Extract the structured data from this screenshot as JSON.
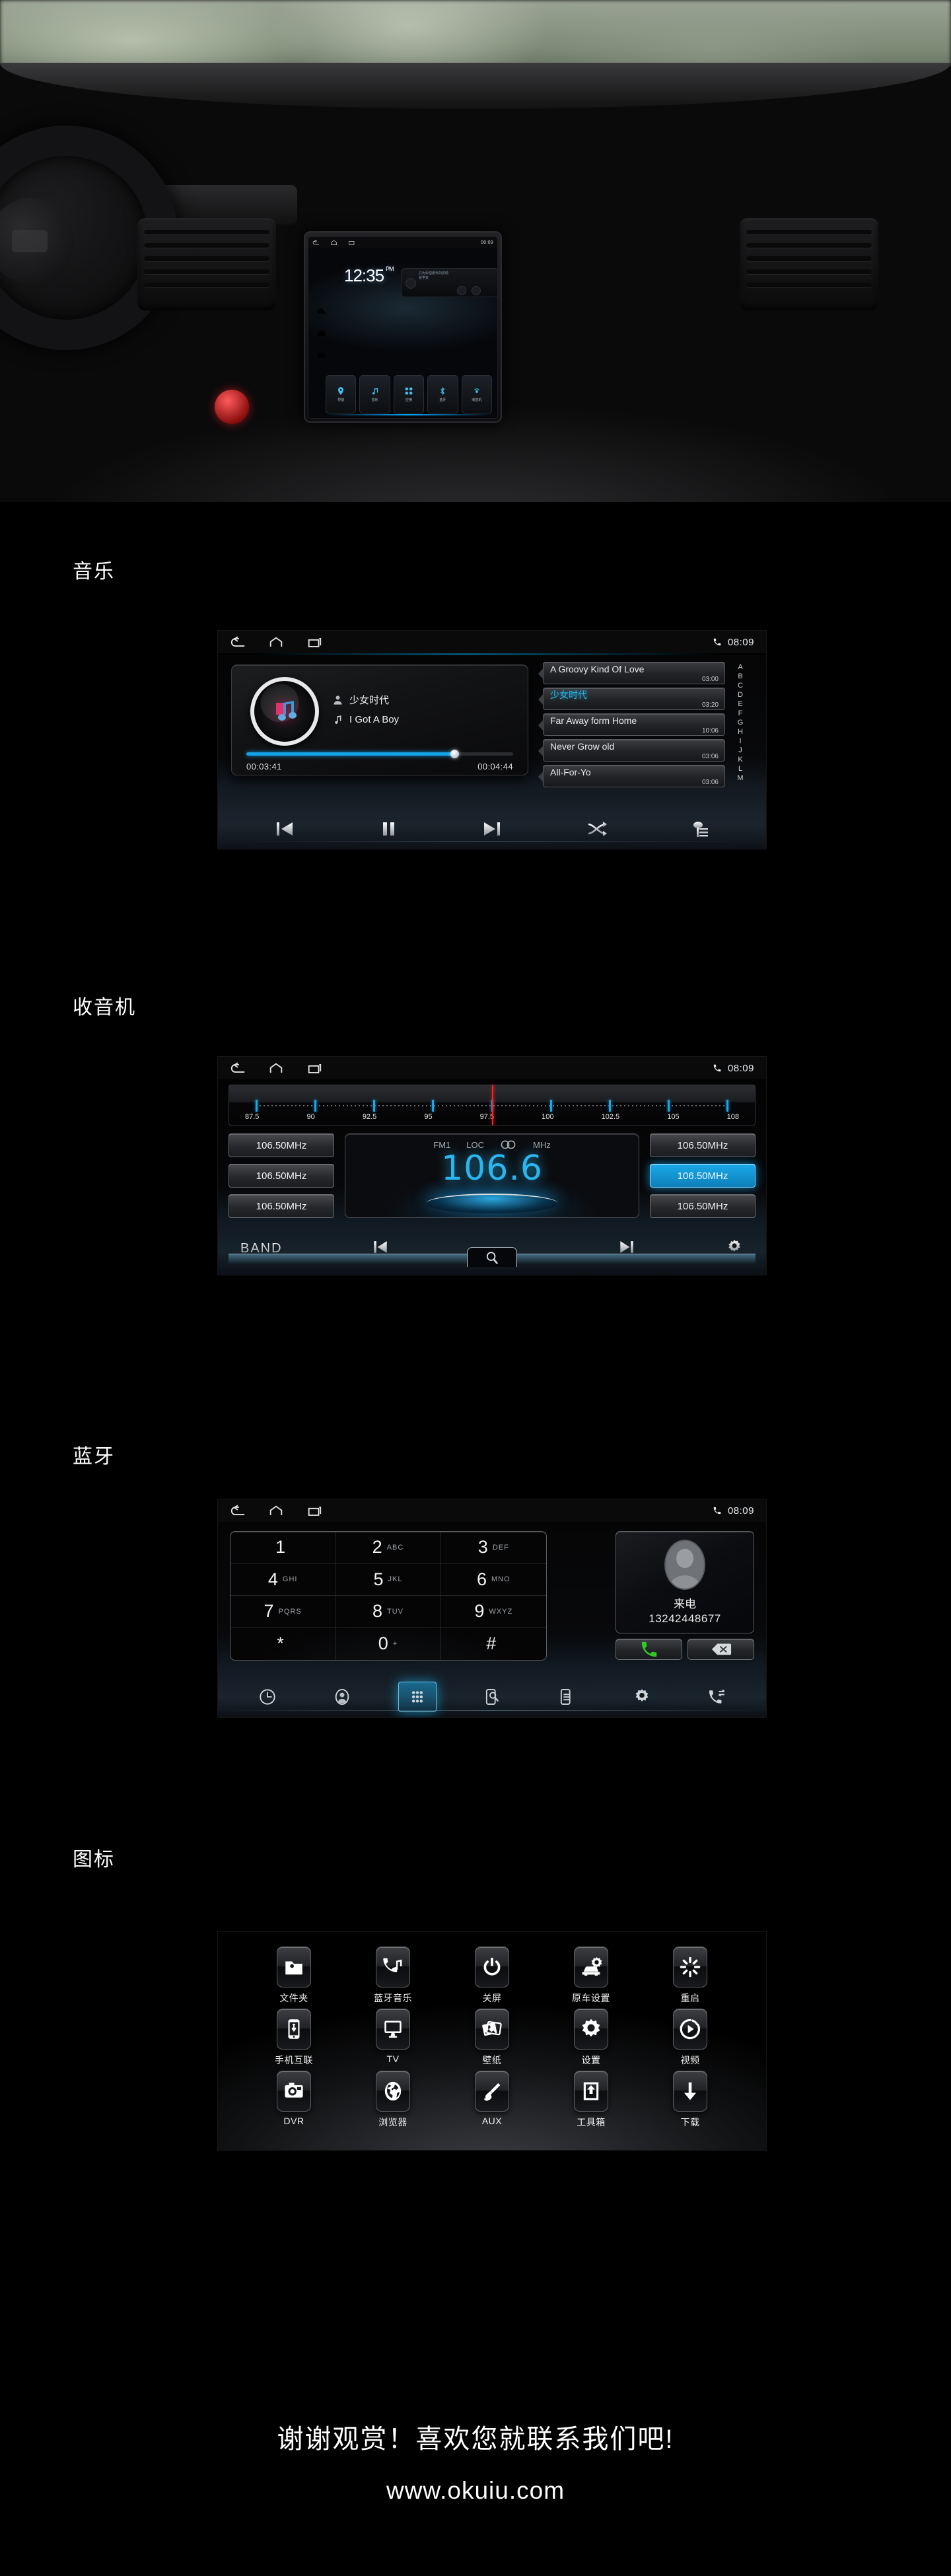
{
  "hero": {
    "headunit": {
      "status_time": "08:09",
      "clock": "12:35",
      "clock_meridiem": "PM",
      "media_line1": "只为永恒那天的爱情",
      "media_line2": "张学友",
      "dock": [
        {
          "label": "导航",
          "icon": "map-pin-icon"
        },
        {
          "label": "音乐",
          "icon": "music-note-icon"
        },
        {
          "label": "应用",
          "icon": "apps-grid-icon"
        },
        {
          "label": "蓝牙",
          "icon": "bluetooth-icon"
        },
        {
          "label": "收音机",
          "icon": "radio-icon"
        }
      ]
    }
  },
  "sections": {
    "music": {
      "title": "音乐"
    },
    "radio": {
      "title": "收音机"
    },
    "bluetooth": {
      "title": "蓝牙"
    },
    "icons": {
      "title": "图标"
    }
  },
  "statusbar": {
    "time": "08:09",
    "back_icon": "back-arrow-icon",
    "home_icon": "home-icon",
    "recents_icon": "recents-icon",
    "phone_icon": "phone-icon"
  },
  "music": {
    "artist": "少女时代",
    "song": "I Got A Boy",
    "elapsed": "00:03:41",
    "duration": "00:04:44",
    "progress_percent": 78,
    "playlist": [
      {
        "title": "A Groovy Kind Of Love",
        "duration": "03:00",
        "active": false
      },
      {
        "title": "少女时代",
        "duration": "03:20",
        "active": true
      },
      {
        "title": "Far Away form Home",
        "duration": "10:06",
        "active": false
      },
      {
        "title": "Never Grow old",
        "duration": "03:06",
        "active": false
      },
      {
        "title": "All-For-Yo",
        "duration": "03:06",
        "active": false
      }
    ],
    "alpha_index": [
      "A",
      "B",
      "C",
      "D",
      "E",
      "F",
      "G",
      "H",
      "I",
      "J",
      "K",
      "L",
      "M"
    ],
    "controls": [
      {
        "name": "previous",
        "icon": "skip-previous-icon"
      },
      {
        "name": "pause",
        "icon": "pause-icon"
      },
      {
        "name": "next",
        "icon": "skip-next-icon"
      },
      {
        "name": "shuffle",
        "icon": "shuffle-icon"
      },
      {
        "name": "playlist",
        "icon": "playlist-icon"
      }
    ],
    "accent_color": "#12a3e8"
  },
  "radio": {
    "scale_labels": [
      "87.5",
      "90",
      "92.5",
      "95",
      "97.5",
      "100",
      "102.5",
      "105",
      "108"
    ],
    "needle_percent": 50,
    "band": "FM1",
    "mode": "LOC",
    "stereo_icon": "stereo-icon",
    "unit": "MHz",
    "frequency": "106.6",
    "presets_left": [
      "106.50MHz",
      "106.50MHz",
      "106.50MHz"
    ],
    "presets_right": [
      "106.50MHz",
      "106.50MHz",
      "106.50MHz"
    ],
    "selected_preset_index": 1,
    "band_label": "BAND",
    "controls": [
      {
        "name": "seek-down",
        "icon": "skip-previous-icon"
      },
      {
        "name": "scan",
        "icon": "search-icon"
      },
      {
        "name": "seek-up",
        "icon": "skip-next-icon"
      },
      {
        "name": "settings",
        "icon": "gear-icon"
      }
    ],
    "accent_color": "#2ab6ef",
    "needle_color": "#ff2020"
  },
  "bluetooth": {
    "keys": [
      {
        "num": "1",
        "sub": ""
      },
      {
        "num": "2",
        "sub": "ABC"
      },
      {
        "num": "3",
        "sub": "DEF"
      },
      {
        "num": "4",
        "sub": "GHI"
      },
      {
        "num": "5",
        "sub": "JKL"
      },
      {
        "num": "6",
        "sub": "MNO"
      },
      {
        "num": "7",
        "sub": "PQRS"
      },
      {
        "num": "8",
        "sub": "TUV"
      },
      {
        "num": "9",
        "sub": "WXYZ"
      },
      {
        "num": "*",
        "sub": ""
      },
      {
        "num": "0",
        "sub": "+"
      },
      {
        "num": "#",
        "sub": ""
      }
    ],
    "call_status": "来电",
    "call_number": "13242448677",
    "answer_icon": "phone-answer-icon",
    "delete_icon": "backspace-icon",
    "nav": [
      {
        "name": "call-history",
        "icon": "clock-icon",
        "active": false
      },
      {
        "name": "contacts",
        "icon": "contact-icon",
        "active": false
      },
      {
        "name": "keypad",
        "icon": "keypad-icon",
        "active": true
      },
      {
        "name": "search-phone",
        "icon": "phone-search-icon",
        "active": false
      },
      {
        "name": "sync-records",
        "icon": "phone-list-icon",
        "active": false
      },
      {
        "name": "bt-settings",
        "icon": "gear-icon",
        "active": false
      },
      {
        "name": "transfer-audio",
        "icon": "call-transfer-icon",
        "active": false
      }
    ],
    "accent_color": "#1eaae6"
  },
  "icons_grid": [
    {
      "label": "文件夹",
      "icon": "folder-icon"
    },
    {
      "label": "蓝牙音乐",
      "icon": "bluetooth-music-icon"
    },
    {
      "label": "关屏",
      "icon": "power-icon"
    },
    {
      "label": "原车设置",
      "icon": "car-settings-icon"
    },
    {
      "label": "重启",
      "icon": "restart-icon"
    },
    {
      "label": "手机互联",
      "icon": "phone-link-icon"
    },
    {
      "label": "TV",
      "icon": "tv-icon"
    },
    {
      "label": "壁纸",
      "icon": "wallpaper-icon"
    },
    {
      "label": "设置",
      "icon": "gear-icon"
    },
    {
      "label": "视频",
      "icon": "video-icon"
    },
    {
      "label": "DVR",
      "icon": "camera-icon"
    },
    {
      "label": "浏览器",
      "icon": "globe-icon"
    },
    {
      "label": "AUX",
      "icon": "aux-plug-icon"
    },
    {
      "label": "工具箱",
      "icon": "toolbox-icon"
    },
    {
      "label": "下载",
      "icon": "download-icon"
    }
  ],
  "footer": {
    "thanks": "谢谢观赏！喜欢您就联系我们吧!",
    "website": "www.okuiu.com"
  }
}
